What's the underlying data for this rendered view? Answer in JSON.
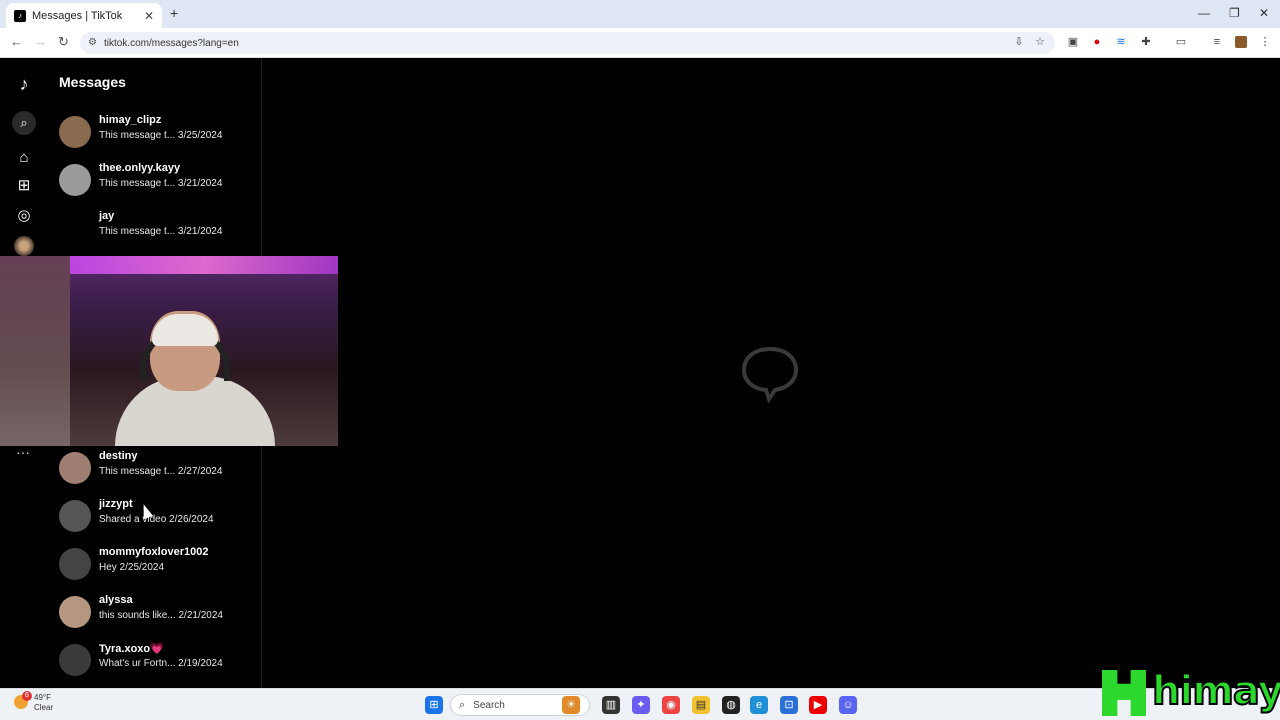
{
  "browser": {
    "tab_title": "Messages | TikTok",
    "url": "tiktok.com/messages?lang=en"
  },
  "page": {
    "title": "Messages"
  },
  "conversations": [
    {
      "name": "himay_clipz",
      "preview": "This message t...  3/25/2024",
      "color": "#8a6b4f"
    },
    {
      "name": "thee.onlyy.kayy",
      "preview": "This message t...  3/21/2024",
      "color": "#9a9a9a"
    },
    {
      "name": "jay",
      "preview": "This message t...  3/21/2024",
      "color": "#000000"
    },
    {
      "name": "destiny",
      "preview": "This message t...  2/27/2024",
      "color": "#a07f72"
    },
    {
      "name": "jizzypt",
      "preview": "Shared a video  2/26/2024",
      "color": "#555555"
    },
    {
      "name": "mommyfoxlover1002",
      "preview": "Hey  2/25/2024",
      "color": "#444444"
    },
    {
      "name": "alyssa",
      "preview": "this sounds like...  2/21/2024",
      "color": "#b59680"
    },
    {
      "name": "Tyra.xoxo💗",
      "preview": "What's ur Fortn...  2/19/2024",
      "color": "#3a3a3a"
    }
  ],
  "taskbar": {
    "temp": "49°F",
    "condition": "Clear",
    "badge": "6",
    "search_label": "Search"
  },
  "overlay": {
    "logo_text": "himay"
  }
}
